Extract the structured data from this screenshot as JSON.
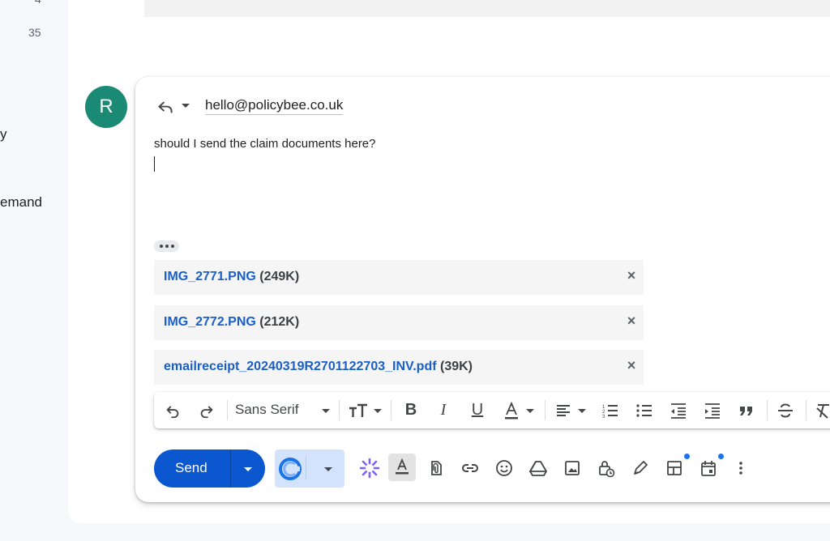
{
  "sidebar": {
    "count_top": "4",
    "count": "35",
    "label_fragment_1": "y",
    "label_fragment_2": "emand"
  },
  "message": {
    "avatar_letter": "R",
    "recipient": "hello@policybee.co.uk",
    "body": "should I send the claim documents here?"
  },
  "attachments": [
    {
      "name": "IMG_2771.PNG",
      "size": "(249K)"
    },
    {
      "name": "IMG_2772.PNG",
      "size": "(212K)"
    },
    {
      "name": "emailreceipt_20240319R2701122703_INV.pdf",
      "size": "(39K)"
    }
  ],
  "toolbar": {
    "font_family": "Sans Serif"
  },
  "actions": {
    "send_label": "Send"
  },
  "colors": {
    "send": "#0b57d0",
    "avatar": "#1a8a74",
    "link": "#1a5fc8",
    "extension": "#d3e3fd"
  }
}
